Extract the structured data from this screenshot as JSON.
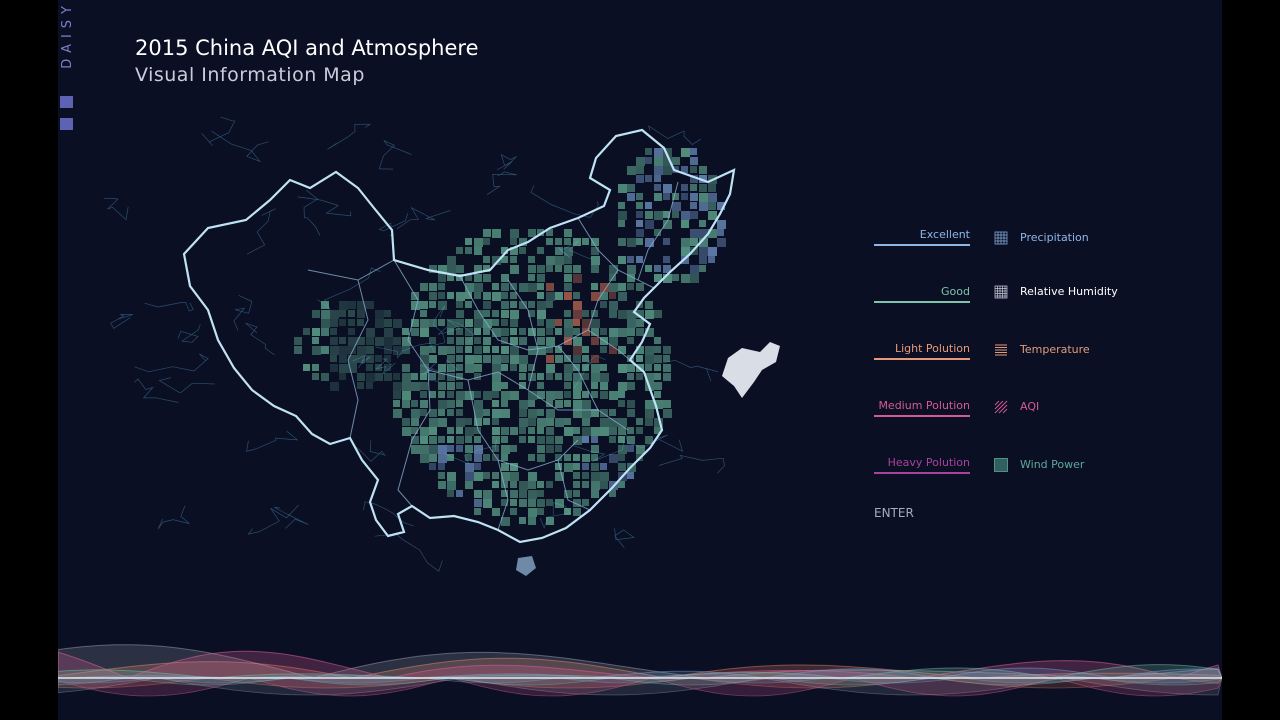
{
  "brand": {
    "text": "DAISY"
  },
  "title": {
    "main": "2015 China AQI and Atmosphere",
    "sub": "Visual Information Map"
  },
  "legend": {
    "levels": [
      {
        "label": "Excellent",
        "color": "#8fb6e6"
      },
      {
        "label": "Good",
        "color": "#7fc4a8"
      },
      {
        "label": "Light Polution",
        "color": "#e69a7a"
      },
      {
        "label": "Medium Polution",
        "color": "#d45b90"
      },
      {
        "label": "Heavy Polution",
        "color": "#a8439c"
      }
    ],
    "indicators": [
      {
        "label": "Precipitation",
        "icon": "grid-fine-icon",
        "color": "#8fb6e6"
      },
      {
        "label": "Relative Humidity",
        "icon": "grid-dots-icon",
        "color": "#ffffff"
      },
      {
        "label": "Temperature",
        "icon": "horizontal-lines-icon",
        "color": "#e69a7a"
      },
      {
        "label": "AQI",
        "icon": "diagonal-lines-icon",
        "color": "#d45b90"
      },
      {
        "label": "Wind Power",
        "icon": "solid-square-icon",
        "color": "#5fa89a"
      }
    ]
  },
  "enter_label": "ENTER",
  "colors": {
    "background": "#0a0f24",
    "border": "#bfe3f5",
    "province": "#8fb6d6",
    "river": "#3b6a8f",
    "good": "#6fc3a3",
    "excellent": "#7ea7dc",
    "light": "#d8765a",
    "medium": "#d45b90"
  }
}
